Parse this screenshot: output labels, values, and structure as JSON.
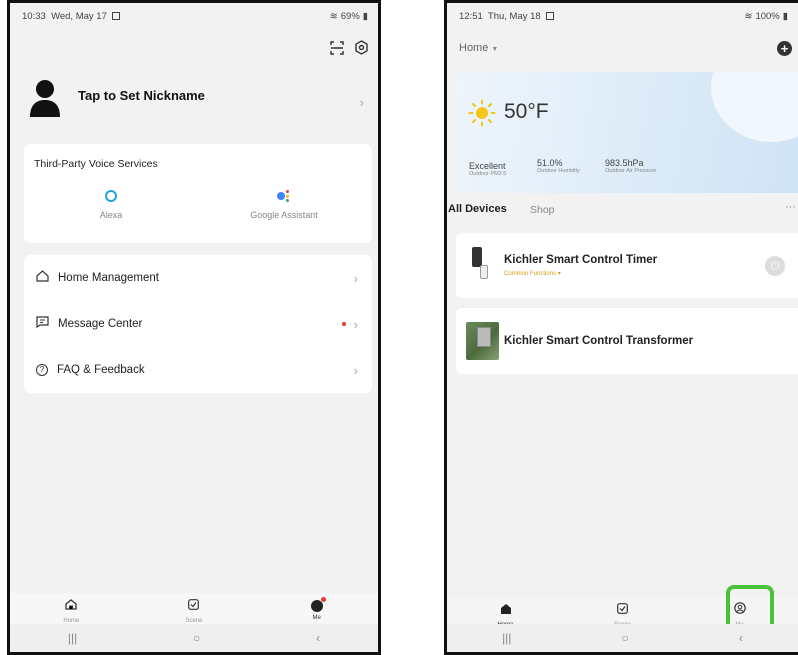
{
  "left": {
    "status": {
      "time": "10:33",
      "date": "Wed, May 17",
      "battery": "69%"
    },
    "profile": {
      "nickname": "Tap to Set Nickname"
    },
    "voice": {
      "title": "Third-Party Voice Services",
      "services": [
        {
          "label": "Alexa"
        },
        {
          "label": "Google Assistant"
        }
      ]
    },
    "menu": [
      {
        "label": "Home Management"
      },
      {
        "label": "Message Center"
      },
      {
        "label": "FAQ & Feedback"
      }
    ],
    "tabs": [
      {
        "label": "Home"
      },
      {
        "label": "Scene"
      },
      {
        "label": "Me"
      }
    ]
  },
  "right": {
    "status": {
      "time": "12:51",
      "date": "Thu, May 18",
      "battery": "100%"
    },
    "home_selector": "Home",
    "weather": {
      "temp": "50°F",
      "stats": [
        {
          "value": "Excellent",
          "label": "Outdoor PM2.5"
        },
        {
          "value": "51.0%",
          "label": "Outdoor Humidity"
        },
        {
          "value": "983.5hPa",
          "label": "Outdoor Air Pressure"
        }
      ]
    },
    "device_tabs": [
      {
        "label": "All Devices"
      },
      {
        "label": "Shop"
      }
    ],
    "devices": [
      {
        "name": "Kichler Smart Control Timer",
        "sub": "Common Functions"
      },
      {
        "name": "Kichler Smart Control Transformer"
      }
    ],
    "tabs": [
      {
        "label": "Home"
      },
      {
        "label": "Scene"
      },
      {
        "label": "Me"
      }
    ]
  },
  "colors": {
    "accent_green": "#49c23b",
    "alexa_blue": "#1fa2e8",
    "badge_red": "#e53935",
    "sun": "#f5c518"
  }
}
